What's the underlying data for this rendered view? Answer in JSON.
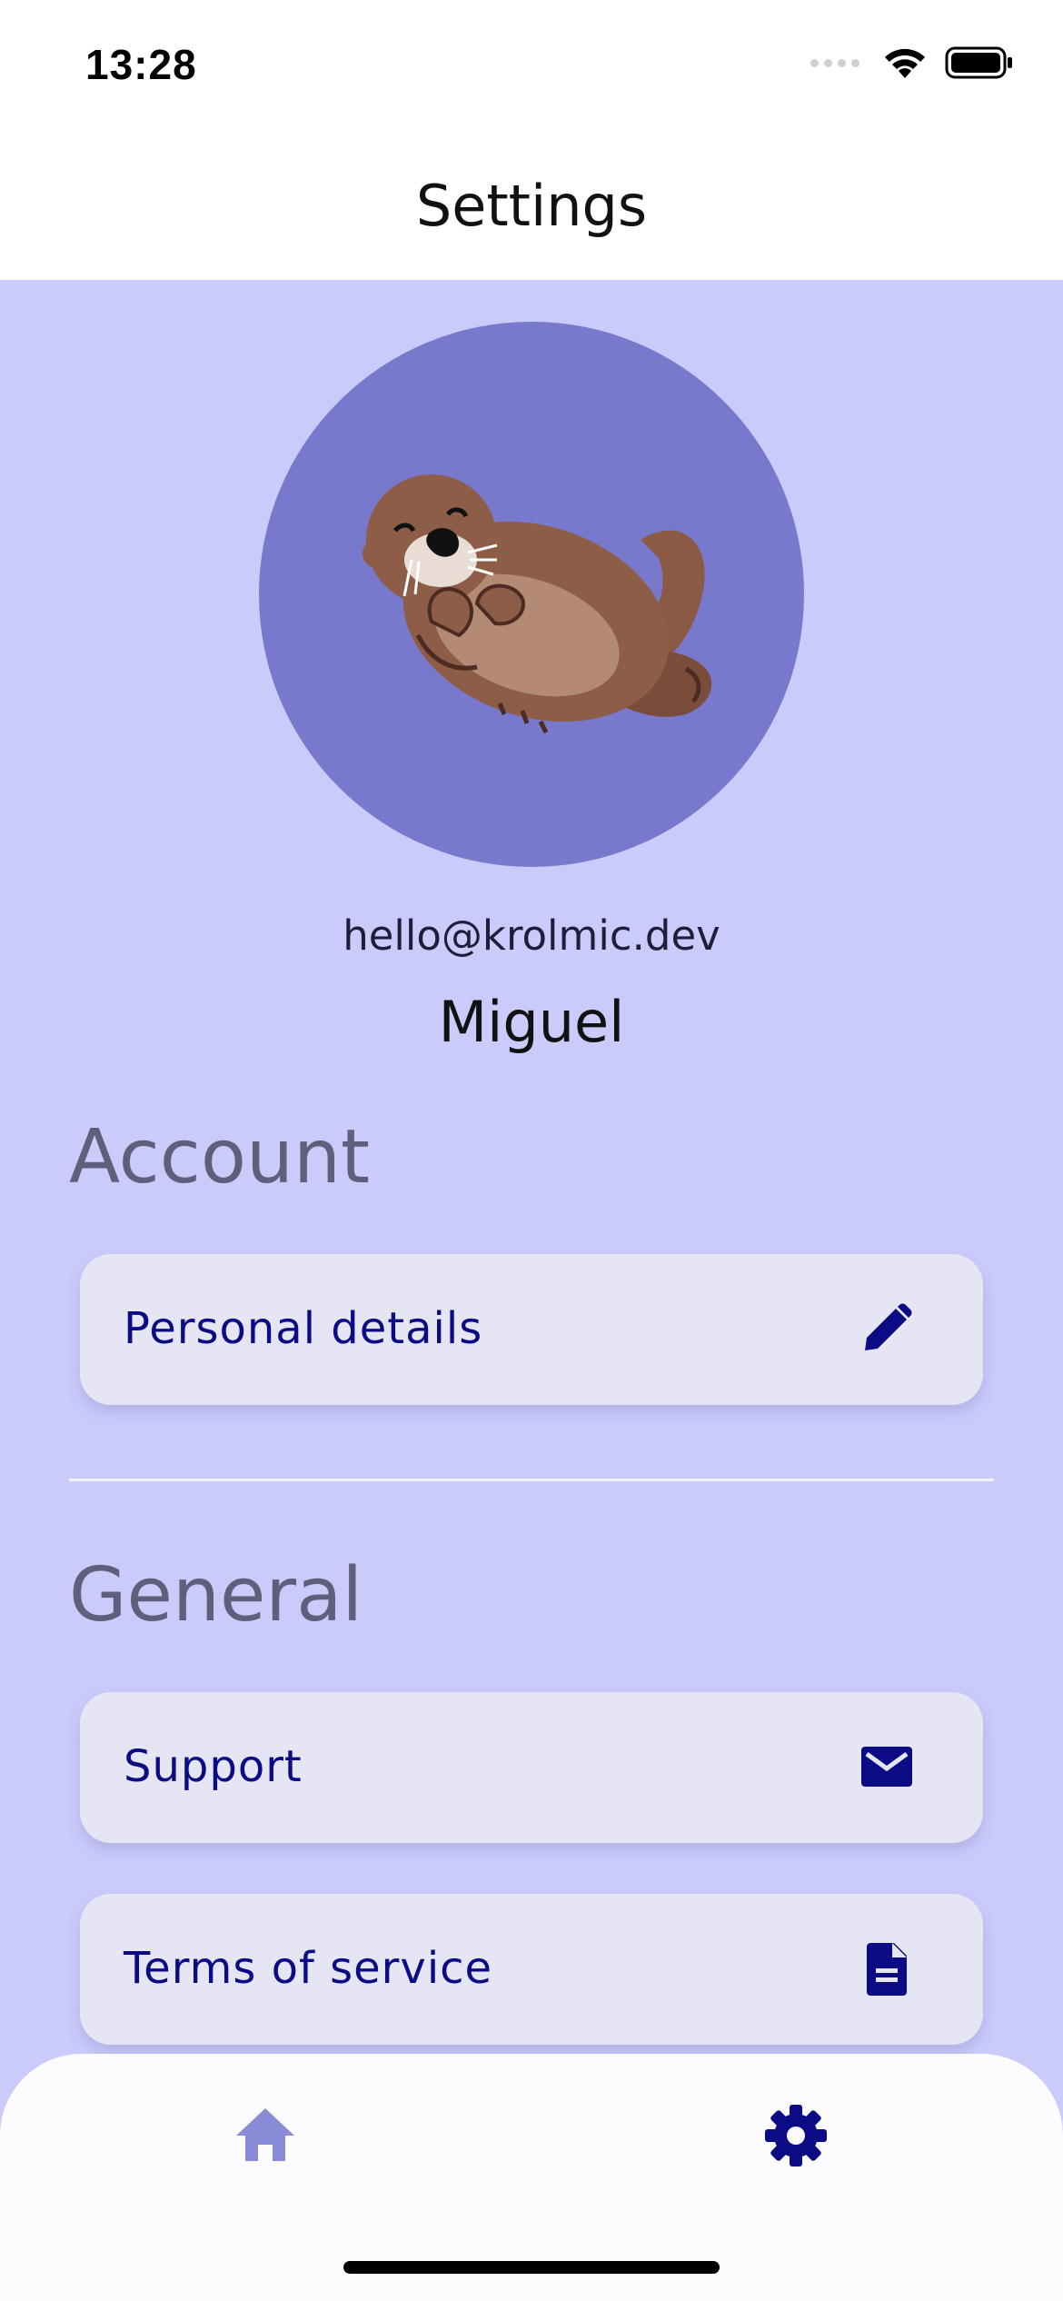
{
  "status_bar": {
    "time": "13:28"
  },
  "header": {
    "title": "Settings"
  },
  "profile": {
    "email": "hello@krolmic.dev",
    "name": "Miguel"
  },
  "sections": [
    {
      "title": "Account",
      "items": [
        {
          "label": "Personal details",
          "icon": "pencil-icon"
        }
      ]
    },
    {
      "title": "General",
      "items": [
        {
          "label": "Support",
          "icon": "mail-icon"
        },
        {
          "label": "Terms of service",
          "icon": "document-icon"
        }
      ]
    }
  ],
  "tab_bar": {
    "tabs": [
      {
        "icon": "home-icon",
        "active": false
      },
      {
        "icon": "gear-icon",
        "active": true
      }
    ]
  },
  "colors": {
    "accent": "#0b0b85",
    "background": "#cbcbfb",
    "avatar_bg": "#7879cc",
    "card_bg": "#e5e5f3",
    "inactive_tab": "#8a8bd6"
  }
}
